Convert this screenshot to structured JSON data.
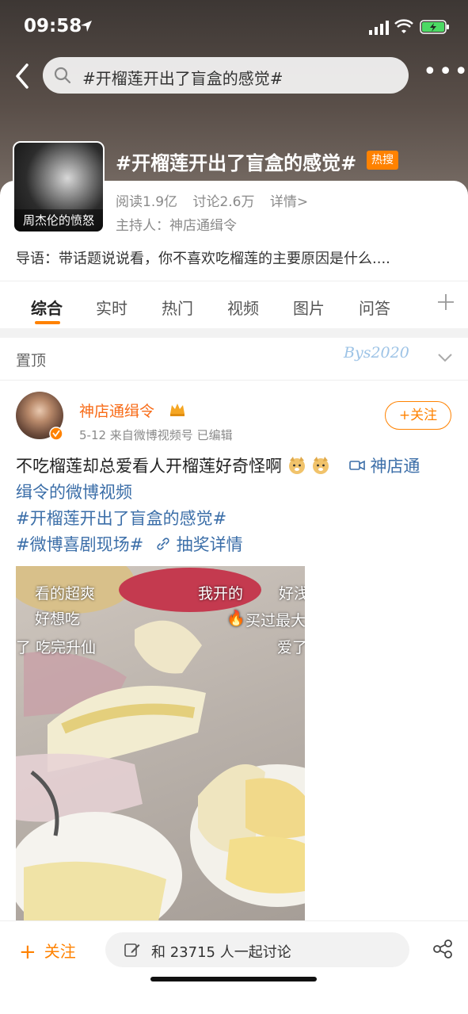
{
  "status_bar": {
    "time": "09:58"
  },
  "header": {
    "search_text": "#开榴莲开出了盲盒的感觉#",
    "more_label": "•••"
  },
  "topic": {
    "cover_label": "周杰伦的愤怒",
    "title": "#开榴莲开出了盲盒的感觉#",
    "hot_badge": "热搜",
    "reads": "阅读1.9亿",
    "discussions": "讨论2.6万",
    "details_link": "详情>",
    "host": "主持人：神店通缉令",
    "intro": "导语：带话题说说看，你不喜欢吃榴莲的主要原因是什么...."
  },
  "tabs": [
    {
      "label": "综合"
    },
    {
      "label": "实时"
    },
    {
      "label": "热门"
    },
    {
      "label": "视频"
    },
    {
      "label": "图片"
    },
    {
      "label": "问答"
    }
  ],
  "pinned": {
    "label": "置顶",
    "watermark": "Bys2020"
  },
  "post": {
    "author": "神店通缉令",
    "meta": "5-12  来自微博视频号  已编辑",
    "follow_label": "+关注",
    "text_main": "不吃榴莲却总爱看人开榴莲好奇怪啊",
    "video_link_part1": "神店通",
    "video_link_part2": "缉令的微博视频",
    "hashtag1": "#开榴莲开出了盲盒的感觉#",
    "hashtag2": "#微博喜剧现场#",
    "lottery_link": "抽奖详情",
    "video_captions": {
      "c1": "看的超爽",
      "c2": "我开的",
      "c3": "好浅",
      "c4": "好想吃",
      "c5": "买过最大",
      "c6": "了 吃完升仙",
      "c7": "爱了"
    }
  },
  "bottom_bar": {
    "follow_label": "关注",
    "follow_plus": "+",
    "discuss_placeholder": "和 23715 人一起讨论"
  },
  "colors": {
    "accent": "#ff8200",
    "link": "#3b6ea8",
    "author": "#f86b17"
  }
}
